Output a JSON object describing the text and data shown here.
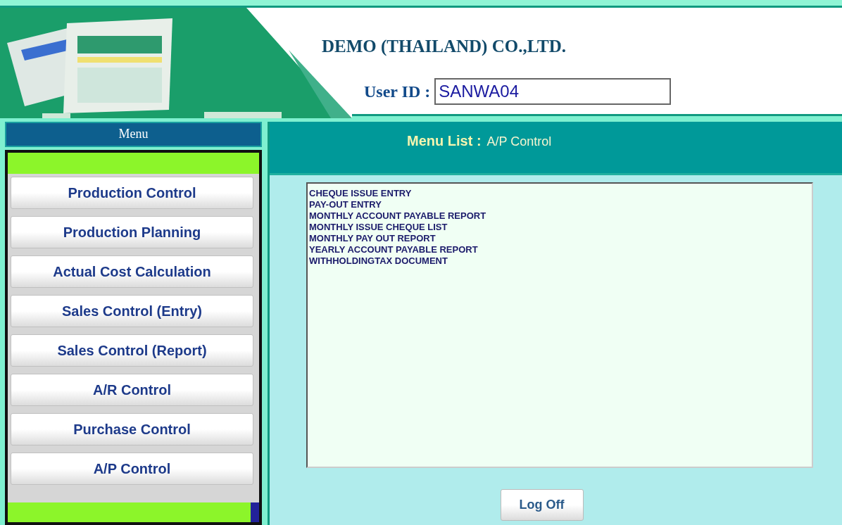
{
  "header": {
    "company": "DEMO (THAILAND) CO.,LTD.",
    "user_id_label": "User ID :",
    "user_id_value": "SANWA04"
  },
  "sidebar": {
    "title": "Menu",
    "items": [
      "Production Control",
      "Production Planning",
      "Actual Cost Calculation",
      "Sales Control (Entry)",
      "Sales Control (Report)",
      "A/R Control",
      "Purchase Control",
      "A/P Control"
    ]
  },
  "content": {
    "title_label": "Menu List :",
    "title_value": "A/P Control",
    "list_items": [
      "CHEQUE ISSUE ENTRY",
      "PAY-OUT ENTRY",
      "MONTHLY ACCOUNT PAYABLE REPORT",
      "MONTHLY ISSUE CHEQUE LIST",
      "MONTHLY PAY OUT REPORT",
      "YEARLY ACCOUNT PAYABLE REPORT",
      "WITHHOLDINGTAX DOCUMENT"
    ],
    "button": "Log Off"
  }
}
